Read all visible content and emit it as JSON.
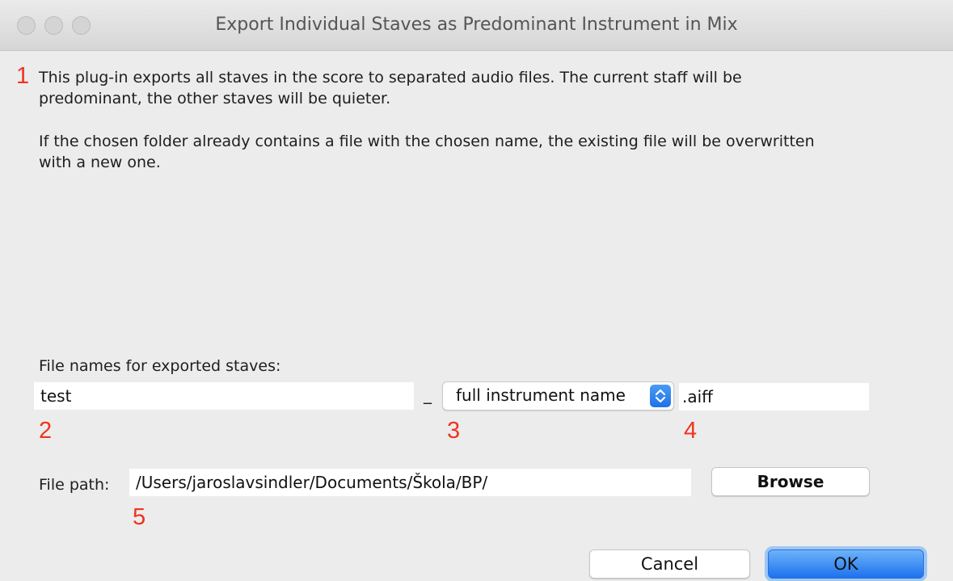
{
  "window": {
    "title": "Export Individual Staves as Predominant Instrument in Mix"
  },
  "annotations": {
    "a1": "1",
    "a2": "2",
    "a3": "3",
    "a4": "4",
    "a5": "5"
  },
  "description": {
    "p1_line1": "This plug-in exports all staves in the score to separated audio files. The current staff will be",
    "p1_line2": "predominant, the other staves will be quieter.",
    "p2_line1": "If the chosen folder already contains a file with the chosen name, the existing file will be overwritten",
    "p2_line2": "with a new one."
  },
  "file_names": {
    "label": "File names for exported staves:",
    "prefix_value": "test",
    "separator": "_",
    "suffix_option": "full instrument name",
    "extension_value": ".aiff"
  },
  "file_path": {
    "label": "File path:",
    "value": "/Users/jaroslavsindler/Documents/Škola/BP/",
    "browse_label": "Browse"
  },
  "buttons": {
    "cancel": "Cancel",
    "ok": "OK"
  },
  "colors": {
    "annotation": "#f0341e",
    "accent": "#1f72e8",
    "background": "#ececec"
  }
}
